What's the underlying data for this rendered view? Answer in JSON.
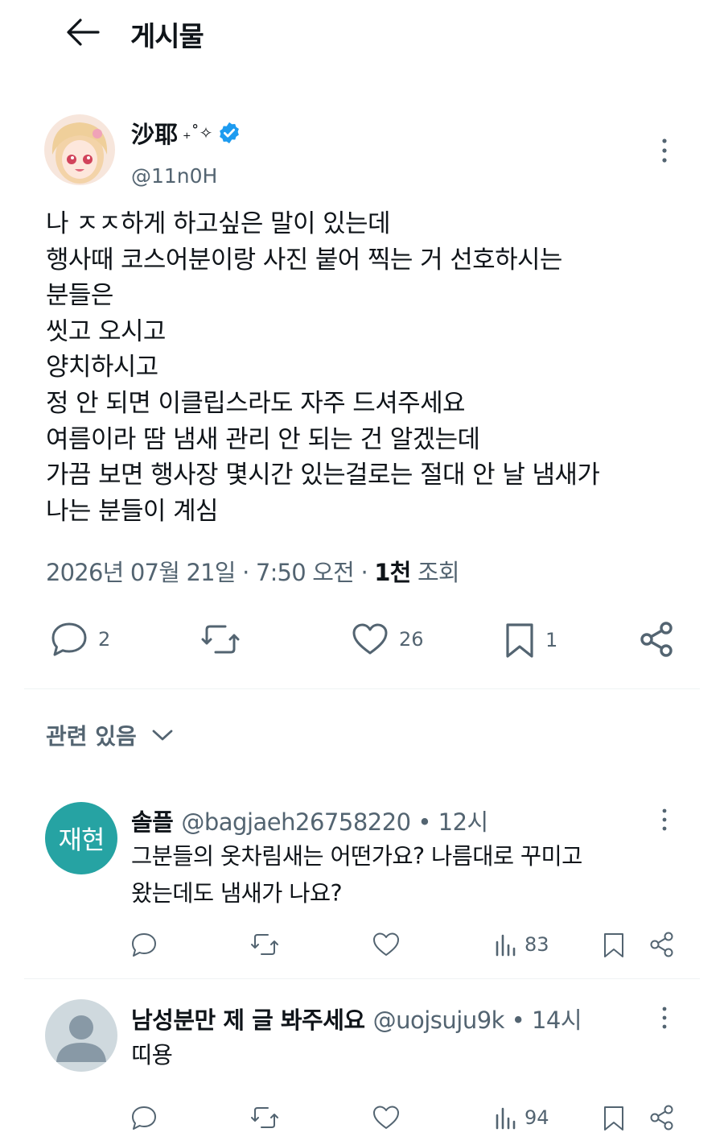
{
  "header": {
    "title": "게시물"
  },
  "post": {
    "author": {
      "name": "沙耶",
      "decoration": "₊˚✧",
      "handle": "@11n0H",
      "verified": true
    },
    "body": "나 ㅈㅈ하게 하고싶은 말이 있는데\n행사때 코스어분이랑 사진 붙어 찍는 거 선호하시는\n분들은\n씻고 오시고\n양치하시고\n정 안 되면 이클립스라도 자주 드셔주세요\n여름이라 땀 냄새 관리 안 되는 건 알겠는데\n가끔 보면 행사장 몇시간 있는걸로는 절대 안 날 냄새가\n나는 분들이 계심",
    "meta": {
      "date": "2026년 07월 21일 · 7:50 오전 · ",
      "views_count": "1천",
      "views_label": " 조회"
    },
    "actions": {
      "replies": "2",
      "likes": "26",
      "bookmarks": "1"
    }
  },
  "related": {
    "label": "관련 있음"
  },
  "replies": [
    {
      "avatar_text": "재현",
      "avatar_color": "#26a3a3",
      "name": "솔플",
      "meta": "@bagjaeh26758220 • 12시",
      "text": "그분들의 옷차림새는 어떤가요? 나름대로 꾸미고\n왔는데도 냄새가 나요?",
      "views": "83"
    },
    {
      "avatar_text": "",
      "avatar_color": "#cfd9de",
      "name": "남성분만 제 글 봐주세요",
      "meta": "@uojsuju9k • 14시",
      "text": "띠용",
      "views": "94"
    }
  ],
  "colors": {
    "text": "#0f1419",
    "secondary": "#536471",
    "verified": "#1d9bf0",
    "divider": "#eff3f4"
  }
}
